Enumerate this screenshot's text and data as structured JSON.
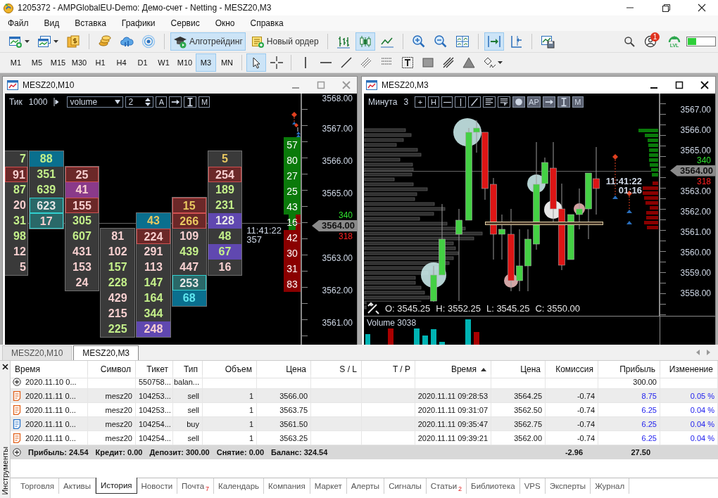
{
  "window": {
    "title": "1205372 - AMPGlobalEU-Demo: Демо-счет - Netting - MESZ20,M3"
  },
  "menu": [
    "Файл",
    "Вид",
    "Вставка",
    "Графики",
    "Сервис",
    "Окно",
    "Справка"
  ],
  "toolbar": [
    {
      "kind": "new-chart",
      "selected": false,
      "dropdown": true
    },
    {
      "kind": "profiles",
      "selected": false,
      "dropdown": true
    },
    {
      "kind": "wallet",
      "selected": false
    },
    {
      "kind": "separator"
    },
    {
      "kind": "coins",
      "selected": false
    },
    {
      "kind": "cloud",
      "selected": false
    },
    {
      "kind": "broadcast",
      "selected": false
    },
    {
      "kind": "separator"
    },
    {
      "kind": "algo",
      "label": "Алготрейдинг",
      "selected": true
    },
    {
      "kind": "new-order",
      "label": "Новый ордер",
      "selected": false
    },
    {
      "kind": "separator"
    },
    {
      "kind": "bars",
      "selected": false
    },
    {
      "kind": "candles",
      "selected": true
    },
    {
      "kind": "line",
      "selected": false
    },
    {
      "kind": "separator"
    },
    {
      "kind": "zoom-in",
      "selected": false
    },
    {
      "kind": "zoom-out",
      "selected": false
    },
    {
      "kind": "tile",
      "selected": false
    },
    {
      "kind": "separator"
    },
    {
      "kind": "autoscroll",
      "selected": true
    },
    {
      "kind": "shift",
      "selected": false
    },
    {
      "kind": "separator"
    },
    {
      "kind": "template",
      "selected": false
    }
  ],
  "status_area": {
    "notifications": "1",
    "level": "LVL"
  },
  "timeframes": [
    {
      "label": "M1",
      "selected": false
    },
    {
      "label": "M5",
      "selected": false
    },
    {
      "label": "M15",
      "selected": false
    },
    {
      "label": "M30",
      "selected": false
    },
    {
      "label": "H1",
      "selected": false
    },
    {
      "label": "H4",
      "selected": false
    },
    {
      "label": "D1",
      "selected": false
    },
    {
      "label": "W1",
      "selected": false
    },
    {
      "label": "M10",
      "selected": false
    },
    {
      "label": "M3",
      "selected": true
    },
    {
      "label": "MN",
      "selected": false
    }
  ],
  "draw_tools": [
    {
      "kind": "cursor",
      "selected": true
    },
    {
      "kind": "crosshair",
      "selected": false
    },
    {
      "kind": "separator"
    },
    {
      "kind": "vline",
      "selected": false
    },
    {
      "kind": "hline",
      "selected": false
    },
    {
      "kind": "trend",
      "selected": false
    },
    {
      "kind": "channel",
      "selected": false
    },
    {
      "kind": "fibo",
      "selected": false
    },
    {
      "kind": "text",
      "selected": false
    },
    {
      "kind": "rect",
      "selected": false
    },
    {
      "kind": "fan",
      "selected": false
    },
    {
      "kind": "triangle",
      "selected": false
    },
    {
      "kind": "shapes",
      "selected": false
    }
  ],
  "charts": [
    {
      "kind": "footprint",
      "title": "MESZ20,M10",
      "period": "Тик",
      "period_value": "1000",
      "mode": "volume",
      "step": "2",
      "tools": [
        {
          "kind": "glyph",
          "text": "A",
          "selected": false
        },
        {
          "kind": "arrow",
          "selected": false
        },
        {
          "kind": "ibeam",
          "selected": false
        },
        {
          "kind": "glyph",
          "text": "M",
          "selected": false
        }
      ],
      "axis": [
        {
          "kind": "label",
          "text": "3568.00"
        },
        {
          "kind": "label",
          "text": "3567.00"
        },
        {
          "kind": "label",
          "text": "3566.00"
        },
        {
          "kind": "label",
          "text": "3565.00"
        },
        {
          "kind": "tag",
          "text": "3564.00"
        },
        {
          "kind": "label",
          "text": "3563.00"
        },
        {
          "kind": "label",
          "text": "3562.00"
        },
        {
          "kind": "label",
          "text": "3561.00"
        }
      ],
      "ask_total": "340",
      "bid_total": "318",
      "time": "11:41:22",
      "time_sub": "357",
      "dom": [
        {
          "text": "57",
          "kind": "ask"
        },
        {
          "text": "80",
          "kind": "ask"
        },
        {
          "text": "27",
          "kind": "ask"
        },
        {
          "text": "25",
          "kind": "ask"
        },
        {
          "text": "43",
          "kind": "ask"
        },
        {
          "text": "16",
          "kind": "mid"
        },
        {
          "text": "42",
          "kind": "bid"
        },
        {
          "text": "30",
          "kind": "bid"
        },
        {
          "text": "31",
          "kind": "bid"
        },
        {
          "text": "83",
          "kind": "bid"
        }
      ],
      "footprint": [
        [
          {
            "text": "7",
            "kind": "buy-plain"
          },
          {
            "text": "91",
            "kind": "sell-boxed"
          },
          {
            "text": "87",
            "kind": "buy-plain"
          },
          {
            "text": "20",
            "kind": "sell-plain"
          },
          {
            "text": "31",
            "kind": "buy-plain"
          },
          {
            "text": "98",
            "kind": "buy-plain"
          },
          {
            "text": "12",
            "kind": "sell-plain"
          },
          {
            "text": "5",
            "kind": "sell-plain"
          }
        ],
        [
          {
            "text": "88",
            "kind": "buy-max"
          },
          {
            "text": "351",
            "kind": "buy-plain"
          },
          {
            "text": "639",
            "kind": "buy-plain"
          },
          {
            "text": "623",
            "kind": "neutral-framed"
          },
          {
            "text": "17",
            "kind": "sell-framed"
          }
        ],
        [
          {
            "text": "25",
            "kind": "sell-boxed"
          },
          {
            "text": "41",
            "kind": "sell-delta"
          },
          {
            "text": "155",
            "kind": "sell-boxed"
          },
          {
            "text": "305",
            "kind": "buy-plain"
          },
          {
            "text": "607",
            "kind": "buy-plain"
          },
          {
            "text": "431",
            "kind": "sell-plain"
          },
          {
            "text": "153",
            "kind": "sell-plain"
          },
          {
            "text": "24",
            "kind": "sell-plain"
          }
        ],
        [
          {
            "text": "81",
            "kind": "sell-plain"
          },
          {
            "text": "102",
            "kind": "sell-plain"
          },
          {
            "text": "157",
            "kind": "buy-plain"
          },
          {
            "text": "228",
            "kind": "buy-plain"
          },
          {
            "text": "429",
            "kind": "sell-plain"
          },
          {
            "text": "215",
            "kind": "sell-plain"
          },
          {
            "text": "225",
            "kind": "buy-plain"
          }
        ],
        [
          {
            "text": "43",
            "kind": "gold-max"
          },
          {
            "text": "224",
            "kind": "sell-boxed"
          },
          {
            "text": "291",
            "kind": "sell-plain"
          },
          {
            "text": "113",
            "kind": "sell-plain"
          },
          {
            "text": "147",
            "kind": "buy-plain"
          },
          {
            "text": "164",
            "kind": "buy-plain"
          },
          {
            "text": "344",
            "kind": "buy-plain"
          },
          {
            "text": "248",
            "kind": "sell-peak"
          }
        ],
        [
          {
            "text": "15",
            "kind": "gold-boxed"
          },
          {
            "text": "266",
            "kind": "gold-boxed"
          },
          {
            "text": "109",
            "kind": "sell-plain"
          },
          {
            "text": "439",
            "kind": "buy-plain"
          },
          {
            "text": "447",
            "kind": "sell-plain"
          },
          {
            "text": "253",
            "kind": "neutral-framed"
          },
          {
            "text": "68",
            "kind": "cyan-max"
          }
        ],
        [
          {
            "text": "5",
            "kind": "gold-plain"
          },
          {
            "text": "254",
            "kind": "sell-boxed"
          },
          {
            "text": "189",
            "kind": "buy-plain"
          },
          {
            "text": "231",
            "kind": "buy-plain"
          },
          {
            "text": "128",
            "kind": "neutral-peak"
          },
          {
            "text": "48",
            "kind": "buy-plain"
          },
          {
            "text": "67",
            "kind": "buy-peak"
          },
          {
            "text": "16",
            "kind": "sell-plain"
          }
        ]
      ]
    },
    {
      "kind": "candles",
      "title": "MESZ20,M3",
      "period": "Минута",
      "period_value": "3",
      "tools": [
        {
          "kind": "glyph",
          "text": "+",
          "selected": false
        },
        {
          "kind": "glyph",
          "text": "H",
          "selected": false
        },
        {
          "kind": "hline",
          "selected": false
        },
        {
          "kind": "vline",
          "selected": false
        },
        {
          "kind": "slash",
          "selected": false
        },
        {
          "kind": "align",
          "selected": false
        },
        {
          "kind": "flines",
          "selected": false
        },
        {
          "kind": "dot",
          "selected": true
        },
        {
          "kind": "glyph",
          "text": "AP",
          "selected": true
        },
        {
          "kind": "arrow",
          "selected": true
        },
        {
          "kind": "ibeam",
          "selected": true
        },
        {
          "kind": "glyph",
          "text": "M",
          "selected": true
        }
      ],
      "axis": [
        {
          "kind": "label",
          "text": "3567.00"
        },
        {
          "kind": "label",
          "text": "3566.00"
        },
        {
          "kind": "label",
          "text": "3565.00"
        },
        {
          "kind": "tag",
          "text": "3564.00"
        },
        {
          "kind": "label",
          "text": "3563.00"
        },
        {
          "kind": "label",
          "text": "3562.00"
        },
        {
          "kind": "label",
          "text": "3561.00"
        },
        {
          "kind": "label",
          "text": "3560.00"
        },
        {
          "kind": "label",
          "text": "3559.00"
        },
        {
          "kind": "label",
          "text": "3558.00"
        }
      ],
      "ask_total": "340",
      "bid_total": "318",
      "time": "11:41:22",
      "time_sub": "01:16",
      "ohlc": [
        "O: 3545.25",
        "H: 3552.25",
        "L: 3545.25",
        "C: 3550.00"
      ],
      "volume_label": "Volume 3038"
    }
  ],
  "doc_tabs": [
    {
      "label": "MESZ20,M10",
      "selected": false
    },
    {
      "label": "MESZ20,M3",
      "selected": true
    }
  ],
  "toolbox": {
    "title": "Инструменты",
    "columns": [
      {
        "label": "Время",
        "sorted": false
      },
      {
        "label": "Символ",
        "sorted": false
      },
      {
        "label": "Тикет",
        "sorted": false
      },
      {
        "label": "Тип",
        "sorted": false
      },
      {
        "label": "Объем",
        "sorted": false
      },
      {
        "label": "Цена",
        "sorted": false
      },
      {
        "label": "S / L",
        "sorted": false
      },
      {
        "label": "T / P",
        "sorted": false
      },
      {
        "label": "Время",
        "sorted": true
      },
      {
        "label": "Цена",
        "sorted": false
      },
      {
        "label": "Комиссия",
        "sorted": false
      },
      {
        "label": "Прибыль",
        "sorted": false
      },
      {
        "label": "Изменение",
        "sorted": false
      }
    ],
    "rows": [
      {
        "kind": "balance",
        "cells": [
          "2020.11.10 0...",
          null,
          "550758...",
          "balan...",
          null,
          null,
          null,
          null,
          null,
          null,
          null,
          "300.00",
          null
        ]
      },
      {
        "kind": "sell",
        "cells": [
          "2020.11.11 0...",
          "mesz20",
          "104253...",
          "sell",
          "1",
          "3566.00",
          null,
          null,
          "2020.11.11 09:28:53",
          "3564.25",
          "-0.74",
          "8.75",
          "0.05 %"
        ]
      },
      {
        "kind": "sell",
        "cells": [
          "2020.11.11 0...",
          "mesz20",
          "104253...",
          "sell",
          "1",
          "3563.75",
          null,
          null,
          "2020.11.11 09:31:07",
          "3562.50",
          "-0.74",
          "6.25",
          "0.04 %"
        ]
      },
      {
        "kind": "buy",
        "cells": [
          "2020.11.11 0...",
          "mesz20",
          "104254...",
          "buy",
          "1",
          "3561.50",
          null,
          null,
          "2020.11.11 09:35:47",
          "3562.75",
          "-0.74",
          "6.25",
          "0.04 %"
        ]
      },
      {
        "kind": "sell",
        "cells": [
          "2020.11.11 0...",
          "mesz20",
          "104254...",
          "sell",
          "1",
          "3563.25",
          null,
          null,
          "2020.11.11 09:39:21",
          "3562.00",
          "-0.74",
          "6.25",
          "0.04 %"
        ]
      }
    ],
    "summary": {
      "totals": [
        "Прибыль: 24.54",
        "Кредит: 0.00",
        "Депозит: 300.00",
        "Снятие: 0.00",
        "Баланс: 324.54"
      ],
      "commission": "-2.96",
      "profit": "27.50"
    },
    "tabs": [
      {
        "label": "Торговля",
        "selected": false
      },
      {
        "label": "Активы",
        "selected": false
      },
      {
        "label": "История",
        "selected": true
      },
      {
        "label": "Новости",
        "selected": false
      },
      {
        "label": "Почта",
        "selected": false,
        "badge": "7"
      },
      {
        "label": "Календарь",
        "selected": false
      },
      {
        "label": "Компания",
        "selected": false
      },
      {
        "label": "Маркет",
        "selected": false
      },
      {
        "label": "Алерты",
        "selected": false
      },
      {
        "label": "Сигналы",
        "selected": false
      },
      {
        "label": "Статьи",
        "selected": false,
        "badge": "2"
      },
      {
        "label": "Библиотека",
        "selected": false
      },
      {
        "label": "VPS",
        "selected": false
      },
      {
        "label": "Эксперты",
        "selected": false
      },
      {
        "label": "Журнал",
        "selected": false
      }
    ]
  }
}
